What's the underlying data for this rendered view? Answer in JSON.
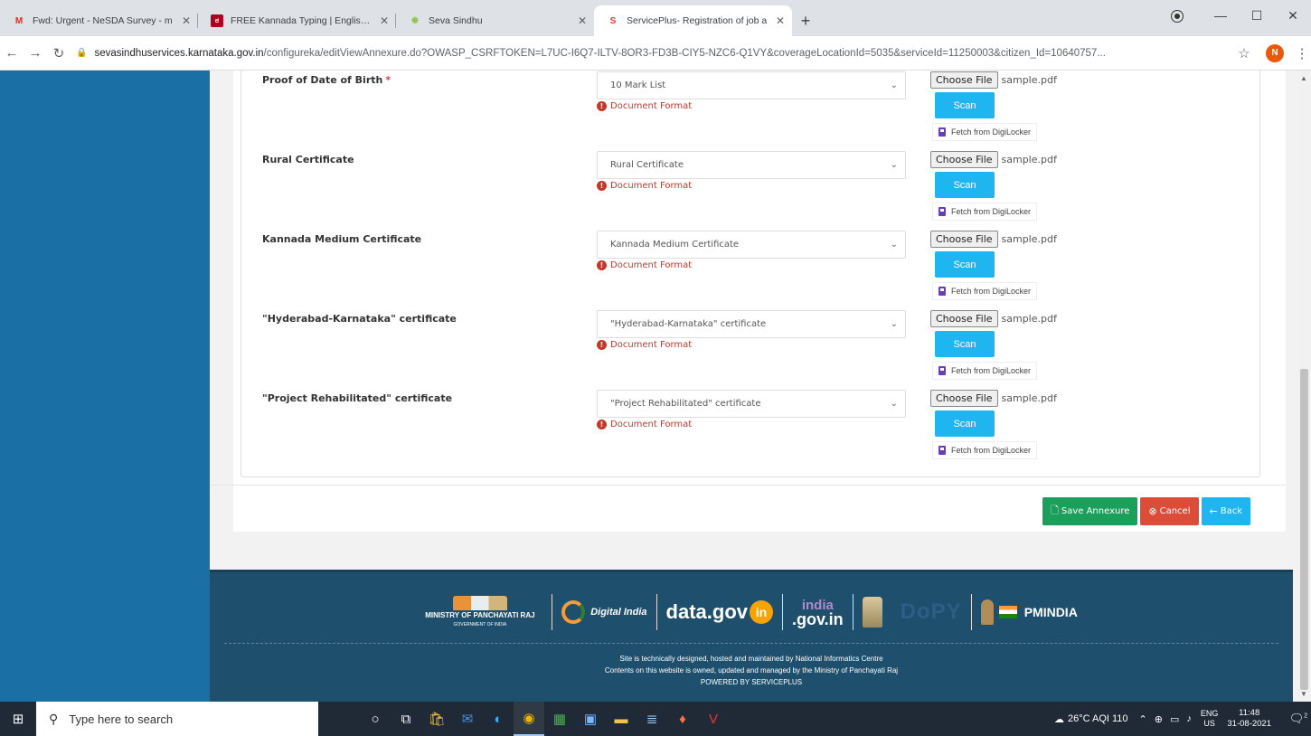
{
  "browser": {
    "tabs": [
      {
        "icon": "gmail-icon",
        "glyph": "M",
        "color": "#d93025",
        "label": "Fwd: Urgent - NeSDA Survey - m"
      },
      {
        "icon": "kannada-typing-icon",
        "glyph": "ಠ",
        "color": "#b00020",
        "label": "FREE Kannada Typing | English to"
      },
      {
        "icon": "seva-sindhu-icon",
        "glyph": "❋",
        "color": "#8bc34a",
        "label": "Seva Sindhu"
      },
      {
        "icon": "serviceplus-icon",
        "glyph": "S",
        "color": "#e53935",
        "label": "ServicePlus- Registration of job a"
      }
    ],
    "url_host": "sevasindhuservices.karnataka.gov.in",
    "url_path": "/configureka/editViewAnnexure.do?OWASP_CSRFTOKEN=L7UC-I6Q7-ILTV-8OR3-FD3B-CIY5-NZC6-Q1VY&coverageLocationId=5035&serviceId=11250003&citizen_Id=10640757...",
    "profile_initial": "N"
  },
  "documents": [
    {
      "label": "Proof of Date of Birth",
      "required": true,
      "selected": "10 Mark List",
      "format_text": "Document Format",
      "choose_label": "Choose File",
      "file_name": "sample.pdf",
      "scan_label": "Scan",
      "digilocker_label": "Fetch from DigiLocker"
    },
    {
      "label": "Rural Certificate",
      "required": false,
      "selected": "Rural Certificate",
      "format_text": "Document Format",
      "choose_label": "Choose File",
      "file_name": "sample.pdf",
      "scan_label": "Scan",
      "digilocker_label": "Fetch from DigiLocker"
    },
    {
      "label": "Kannada Medium Certificate",
      "required": false,
      "selected": "Kannada Medium Certificate",
      "format_text": "Document Format",
      "choose_label": "Choose File",
      "file_name": "sample.pdf",
      "scan_label": "Scan",
      "digilocker_label": "Fetch from DigiLocker"
    },
    {
      "label": "\"Hyderabad-Karnataka\" certificate",
      "required": false,
      "selected": "\"Hyderabad-Karnataka\" certificate",
      "format_text": "Document Format",
      "choose_label": "Choose File",
      "file_name": "sample.pdf",
      "scan_label": "Scan",
      "digilocker_label": "Fetch from DigiLocker"
    },
    {
      "label": "\"Project Rehabilitated\" certificate",
      "required": false,
      "selected": "\"Project Rehabilitated\" certificate",
      "format_text": "Document Format",
      "choose_label": "Choose File",
      "file_name": "sample.pdf",
      "scan_label": "Scan",
      "digilocker_label": "Fetch from DigiLocker"
    }
  ],
  "required_mark": "*",
  "actions": {
    "save_label": "Save Annexure",
    "cancel_label": "Cancel",
    "back_label": "Back"
  },
  "footer": {
    "mopr_line1": "MINISTRY OF PANCHAYATI RAJ",
    "mopr_line2": "GOVERNMENT OF INDIA",
    "digital_india": "Digital India",
    "datagov": "data.gov",
    "datagov_in": "in",
    "indiagov_top": "india",
    "indiagov_bottom": ".gov.in",
    "digiy": "DoPY",
    "pmindia": "PMINDIA",
    "line1": "Site is technically designed, hosted and maintained by National Informatics Centre",
    "line2": "Contents on this website is owned, updated and managed by the Ministry of Panchayati Raj",
    "line3": "POWERED BY SERVICEPLUS"
  },
  "taskbar": {
    "search_placeholder": "Type here to search",
    "weather": "26°C  AQI 110",
    "lang_top": "ENG",
    "lang_bottom": "US",
    "time": "11:48",
    "date": "31-08-2021",
    "notif_count": "2"
  }
}
